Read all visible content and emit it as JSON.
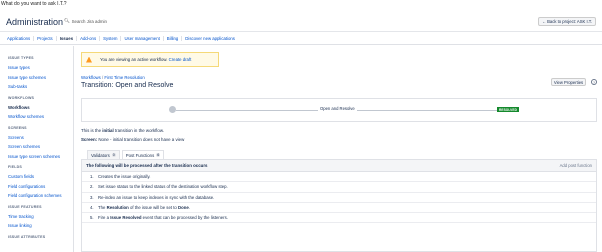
{
  "top_question": "What do you want to ask I.T.?",
  "header": {
    "title": "Administration",
    "search_placeholder": "Search Jira admin",
    "back_button": "Back to project: ASK I.T."
  },
  "nav": [
    "Applications",
    "Projects",
    "Issues",
    "Add-ons",
    "System",
    "User management",
    "Billing",
    "Discover new applications"
  ],
  "nav_active": "Issues",
  "sidebar": [
    {
      "heading": "ISSUE TYPES",
      "items": [
        "Issue types",
        "Issue type schemes",
        "Sub-tasks"
      ]
    },
    {
      "heading": "WORKFLOWS",
      "items": [
        "Workflows",
        "Workflow schemes"
      ]
    },
    {
      "heading": "SCREENS",
      "items": [
        "Screens",
        "Screen schemes",
        "Issue type screen schemes"
      ]
    },
    {
      "heading": "FIELDS",
      "items": [
        "Custom fields",
        "Field configurations",
        "Field configuration schemes"
      ]
    },
    {
      "heading": "ISSUE FEATURES",
      "items": [
        "Time tracking",
        "Issue linking"
      ]
    },
    {
      "heading": "ISSUE ATTRIBUTES",
      "items": []
    }
  ],
  "sidebar_active": "Workflows",
  "banner": {
    "text": "You are viewing an active workflow.",
    "link": "Create draft"
  },
  "breadcrumb": {
    "root": "Workflows",
    "sep": "/",
    "current": "First Time Resolution"
  },
  "transition_title": "Transition: Open and Resolve",
  "view_properties": "View Properties",
  "help_glyph": "?",
  "diagram": {
    "transition_label": "Open and Resolve",
    "target_status": "RESOLVED"
  },
  "desc1": {
    "pre": "This is the ",
    "bold": "initial",
    "post": " transition in the workflow."
  },
  "desc2": {
    "bold": "Screen:",
    "post": " None - initial transition does not have a view"
  },
  "tabs": [
    {
      "label": "Validators",
      "count": "0"
    },
    {
      "label": "Post Functions",
      "count": "6"
    }
  ],
  "post_functions": {
    "heading": "The following will be processed after the transition occurs",
    "add": "Add post function",
    "rows": [
      {
        "num": "1.",
        "parts": [
          {
            "t": "Creates the issue originally."
          }
        ]
      },
      {
        "num": "2.",
        "parts": [
          {
            "t": "Set issue status to the linked status of the destination workflow step."
          }
        ]
      },
      {
        "num": "3.",
        "parts": [
          {
            "t": "Re-index an issue to keep indexes in sync with the database."
          }
        ]
      },
      {
        "num": "4.",
        "parts": [
          {
            "t": "The "
          },
          {
            "t": "Resolution",
            "b": true
          },
          {
            "t": " of the issue will be set to "
          },
          {
            "t": "Done",
            "b": true
          },
          {
            "t": "."
          }
        ]
      },
      {
        "num": "5.",
        "parts": [
          {
            "t": "Fire a "
          },
          {
            "t": "Issue Resolved",
            "b": true
          },
          {
            "t": " event that can be processed by the listeners."
          }
        ]
      }
    ]
  }
}
